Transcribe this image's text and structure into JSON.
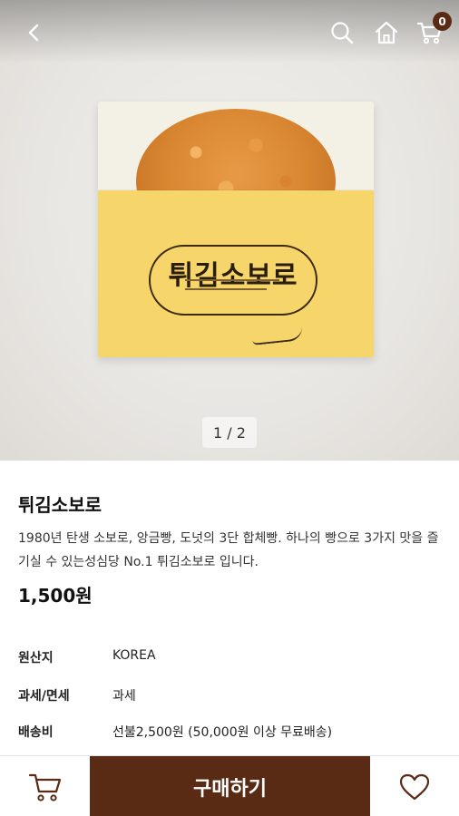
{
  "header": {
    "back_icon": "back-chevron-icon",
    "search_icon": "search-icon",
    "home_icon": "home-icon",
    "cart_icon": "cart-icon",
    "cart_count": "0"
  },
  "gallery": {
    "package_title": "튀김소보로",
    "pager": "1 / 2"
  },
  "product": {
    "name": "튀김소보로",
    "description": "1980년 탄생 소보로, 앙금빵, 도넛의 3단 합체빵. 하나의 빵으로 3가지 맛을 즐기실 수 있는성심당 No.1 튀김소보로 입니다.",
    "price": "1,500원"
  },
  "specs": [
    {
      "label": "원산지",
      "value": "KOREA"
    },
    {
      "label": "과세/면세",
      "value": "과세"
    },
    {
      "label": "배송비",
      "value": "선불2,500원 (50,000원 이상 무료배송)"
    }
  ],
  "bottom_bar": {
    "cart_icon": "cart-icon",
    "buy_label": "구매하기",
    "like_icon": "heart-icon"
  },
  "colors": {
    "accent": "#5a2b14",
    "package_yellow": "#f6d66a"
  }
}
